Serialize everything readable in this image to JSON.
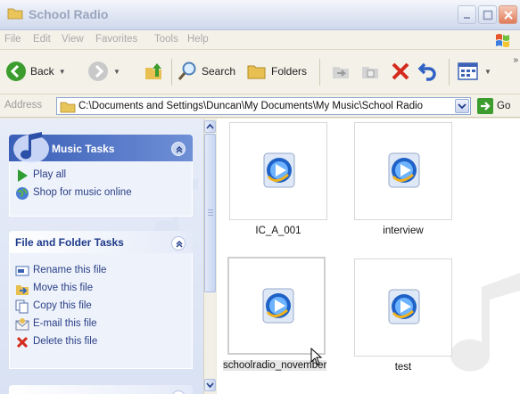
{
  "window": {
    "title": "School Radio"
  },
  "menu": [
    "File",
    "Edit",
    "View",
    "Favorites",
    "Tools",
    "Help"
  ],
  "toolbar": {
    "back_label": "Back",
    "search_label": "Search",
    "folders_label": "Folders"
  },
  "address": {
    "label": "Address",
    "path": "C:\\Documents and Settings\\Duncan\\My Documents\\My Music\\School Radio",
    "go_label": "Go"
  },
  "music_tasks": {
    "title": "Music Tasks",
    "items": [
      {
        "label": "Play all",
        "icon": "play-icon"
      },
      {
        "label": "Shop for music online",
        "icon": "globe-icon"
      }
    ]
  },
  "file_tasks": {
    "title": "File and Folder Tasks",
    "items": [
      {
        "label": "Rename this file",
        "icon": "rename-icon"
      },
      {
        "label": "Move this file",
        "icon": "move-icon"
      },
      {
        "label": "Copy this file",
        "icon": "copy-icon"
      },
      {
        "label": "E-mail this file",
        "icon": "email-icon"
      },
      {
        "label": "Delete this file",
        "icon": "delete-icon"
      }
    ]
  },
  "files": [
    {
      "name": "IC_A_001",
      "selected": false
    },
    {
      "name": "interview",
      "selected": false
    },
    {
      "name": "schoolradio_november",
      "display": "schoolradio_novembеr",
      "selected": true
    },
    {
      "name": "test",
      "selected": false
    }
  ],
  "colors": {
    "task_pane_accent": "#3a5fb7",
    "link_text": "#2a3f86",
    "delete_red": "#d52b1e"
  }
}
